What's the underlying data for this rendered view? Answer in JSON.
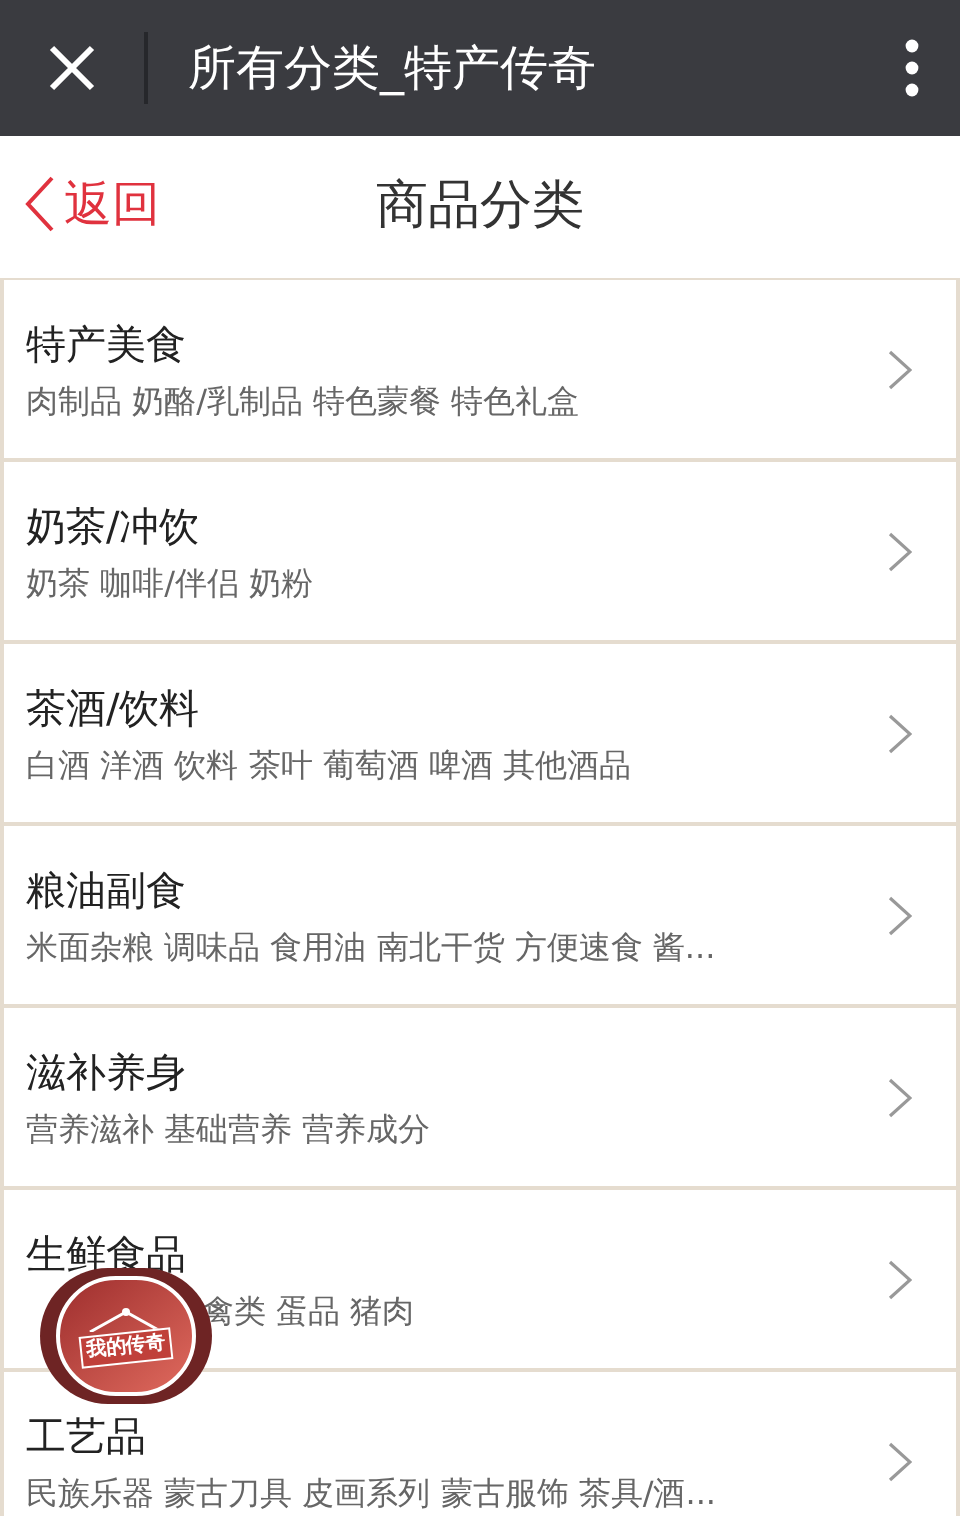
{
  "top_bar": {
    "title": "所有分类_特产传奇"
  },
  "nav": {
    "back": "返回",
    "title": "商品分类"
  },
  "categories": [
    {
      "name": "特产美食",
      "sub": "肉制品 奶酪/乳制品 特色蒙餐 特色礼盒"
    },
    {
      "name": "奶茶/冲饮",
      "sub": "奶茶 咖啡/伴侣 奶粉"
    },
    {
      "name": "茶酒/饮料",
      "sub": "白酒 洋酒 饮料 茶叶 葡萄酒 啤酒 其他酒品"
    },
    {
      "name": "粮油副食",
      "sub": "米面杂粮 调味品 食用油 南北干货 方便速食 酱..."
    },
    {
      "name": "滋补养身",
      "sub": "营养滋补 基础营养 营养成分"
    },
    {
      "name": "生鲜食品",
      "sub": "禽类 蛋品 猪肉",
      "covered": true
    },
    {
      "name": "工艺品",
      "sub": "民族乐器 蒙古刀具 皮画系列 蒙古服饰 茶具/酒..."
    }
  ],
  "floating_badge": {
    "label": "我的传奇"
  }
}
